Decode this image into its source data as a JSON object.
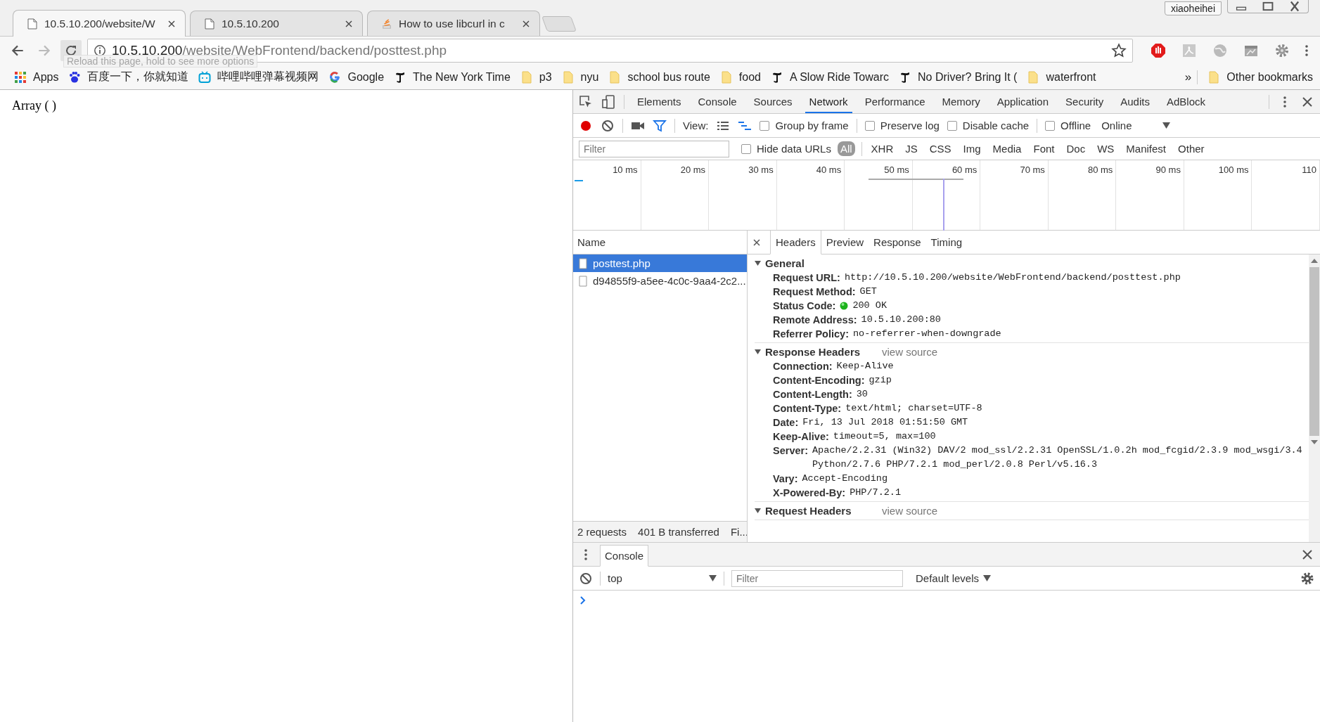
{
  "window": {
    "user": "xiaoheihei"
  },
  "tabs": [
    {
      "title": "10.5.10.200/website/W",
      "selected": true
    },
    {
      "title": "10.5.10.200",
      "selected": false
    },
    {
      "title": "How to use libcurl in c",
      "selected": false
    }
  ],
  "address": {
    "host": "10.5.10.200",
    "path": "/website/WebFrontend/backend/posttest.php"
  },
  "tooltip": "Reload this page, hold to see more options",
  "bookmarks": [
    "Apps",
    "百度一下，你就知道",
    "哔哩哔哩弹幕视频网",
    "Google",
    "The New York Time",
    "p3",
    "nyu",
    "school bus route",
    "food",
    "A Slow Ride Towarc",
    "No Driver? Bring It (",
    "waterfront"
  ],
  "bookmarks_overflow": "»",
  "other_bookmarks": "Other bookmarks",
  "page": {
    "text": "Array ( )"
  },
  "devtools": {
    "panels": [
      {
        "label": "Elements",
        "selected": false
      },
      {
        "label": "Console",
        "selected": false
      },
      {
        "label": "Sources",
        "selected": false
      },
      {
        "label": "Network",
        "selected": true
      },
      {
        "label": "Performance",
        "selected": false
      },
      {
        "label": "Memory",
        "selected": false
      },
      {
        "label": "Application",
        "selected": false
      },
      {
        "label": "Security",
        "selected": false
      },
      {
        "label": "Audits",
        "selected": false
      },
      {
        "label": "AdBlock",
        "selected": false
      }
    ],
    "toolbar": {
      "recording": true,
      "view_label": "View:",
      "options": [
        {
          "label": "Group by frame",
          "checked": false
        },
        {
          "label": "Preserve log",
          "checked": false
        },
        {
          "label": "Disable cache",
          "checked": false
        },
        {
          "label": "Offline",
          "checked": false
        }
      ],
      "throttle": "Online"
    },
    "filter": {
      "placeholder": "Filter",
      "hide_data_urls": {
        "label": "Hide data URLs",
        "checked": false
      },
      "types": [
        {
          "label": "All",
          "selected": true
        },
        {
          "label": "XHR",
          "selected": false
        },
        {
          "label": "JS",
          "selected": false
        },
        {
          "label": "CSS",
          "selected": false
        },
        {
          "label": "Img",
          "selected": false
        },
        {
          "label": "Media",
          "selected": false
        },
        {
          "label": "Font",
          "selected": false
        },
        {
          "label": "Doc",
          "selected": false
        },
        {
          "label": "WS",
          "selected": false
        },
        {
          "label": "Manifest",
          "selected": false
        },
        {
          "label": "Other",
          "selected": false
        }
      ]
    },
    "timeline": {
      "ticks": [
        "10 ms",
        "20 ms",
        "30 ms",
        "40 ms",
        "50 ms",
        "60 ms",
        "70 ms",
        "80 ms",
        "90 ms",
        "100 ms",
        "110"
      ]
    },
    "requests": {
      "column": "Name",
      "items": [
        {
          "name": "posttest.php",
          "selected": true
        },
        {
          "name": "d94855f9-a5ee-4c0c-9aa4-2c2...",
          "selected": false
        }
      ],
      "summary": [
        "2 requests",
        "401 B transferred",
        "Fi..."
      ]
    },
    "detail_tabs": [
      {
        "label": "Headers",
        "selected": true
      },
      {
        "label": "Preview",
        "selected": false
      },
      {
        "label": "Response",
        "selected": false
      },
      {
        "label": "Timing",
        "selected": false
      }
    ],
    "sections": [
      {
        "title": "General",
        "expanded": true,
        "rows": [
          {
            "key": "Request URL:",
            "value": "http://10.5.10.200/website/WebFrontend/backend/posttest.php"
          },
          {
            "key": "Request Method:",
            "value": "GET"
          },
          {
            "key": "Status Code:",
            "value": "200 OK",
            "kind": "status"
          },
          {
            "key": "Remote Address:",
            "value": "10.5.10.200:80"
          },
          {
            "key": "Referrer Policy:",
            "value": "no-referrer-when-downgrade"
          }
        ]
      },
      {
        "title": "Response Headers",
        "expanded": true,
        "link": "view source",
        "rows": [
          {
            "key": "Connection:",
            "value": "Keep-Alive"
          },
          {
            "key": "Content-Encoding:",
            "value": "gzip"
          },
          {
            "key": "Content-Length:",
            "value": "30"
          },
          {
            "key": "Content-Type:",
            "value": "text/html; charset=UTF-8"
          },
          {
            "key": "Date:",
            "value": "Fri, 13 Jul 2018 01:51:50 GMT"
          },
          {
            "key": "Keep-Alive:",
            "value": "timeout=5, max=100"
          },
          {
            "key": "Server:",
            "value": "Apache/2.2.31 (Win32) DAV/2 mod_ssl/2.2.31 OpenSSL/1.0.2h mod_fcgid/2.3.9 mod_wsgi/3.4 Python/2.7.6 PHP/7.2.1 mod_perl/2.0.8 Perl/v5.16.3"
          },
          {
            "key": "Vary:",
            "value": "Accept-Encoding"
          },
          {
            "key": "X-Powered-By:",
            "value": "PHP/7.2.1"
          }
        ]
      },
      {
        "title": "Request Headers",
        "expanded": true,
        "link": "view source"
      }
    ]
  },
  "console": {
    "tab": "Console",
    "context": "top",
    "filter_placeholder": "Filter",
    "levels": "Default levels"
  }
}
